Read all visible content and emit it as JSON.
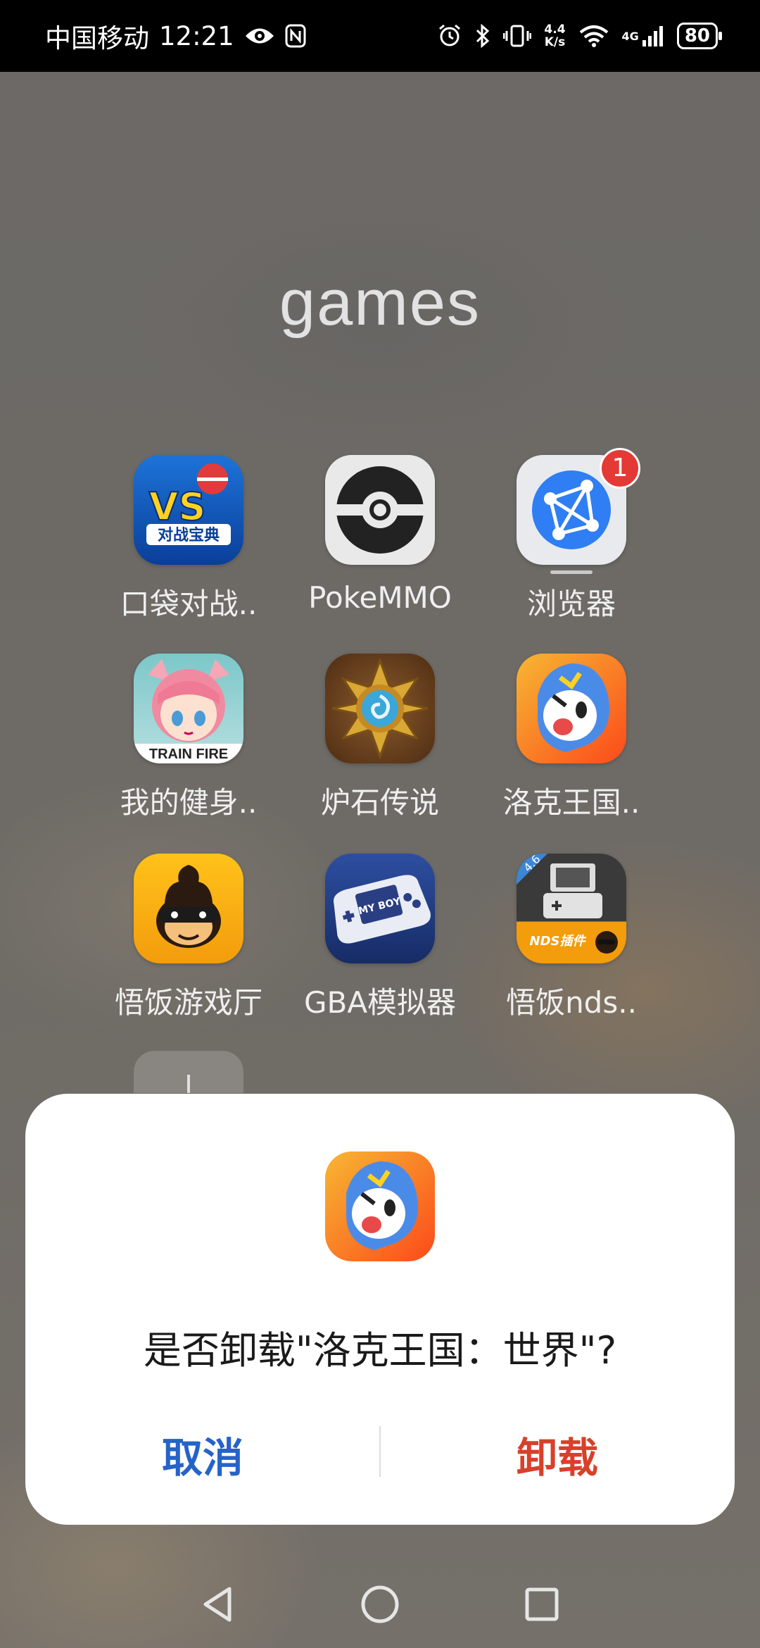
{
  "status_bar": {
    "carrier": "中国移动",
    "time": "12:21",
    "net_speed_value": "4.4",
    "net_speed_unit": "K/s",
    "cell_label": "4G",
    "battery": "80"
  },
  "folder": {
    "title": "games",
    "apps": [
      {
        "label": "口袋对战..",
        "icon": "vs-battle-icon",
        "icon_text": "VS",
        "icon_subtext": "对战宝典"
      },
      {
        "label": "PokeMMO",
        "icon": "pokeball-icon"
      },
      {
        "label": "浏览器",
        "icon": "browser-icon",
        "badge": "1"
      },
      {
        "label": "我的健身..",
        "icon": "anime-girl-icon",
        "icon_text": "TRAIN FIRE"
      },
      {
        "label": "炉石传说",
        "icon": "hearthstone-icon"
      },
      {
        "label": "洛克王国..",
        "icon": "roco-kingdom-icon"
      },
      {
        "label": "悟饭游戏厅",
        "icon": "wufan-monkey-icon"
      },
      {
        "label": "GBA模拟器",
        "icon": "gba-emulator-icon",
        "icon_text": "MY BOY"
      },
      {
        "label": "悟饭nds..",
        "icon": "nds-emulator-icon",
        "icon_text": "NDS插件",
        "icon_version": "4.6"
      }
    ]
  },
  "dialog": {
    "message": "是否卸载\"洛克王国：世界\"?",
    "cancel_label": "取消",
    "confirm_label": "卸载",
    "cancel_color": "#2563c9",
    "confirm_color": "#d8402a"
  }
}
